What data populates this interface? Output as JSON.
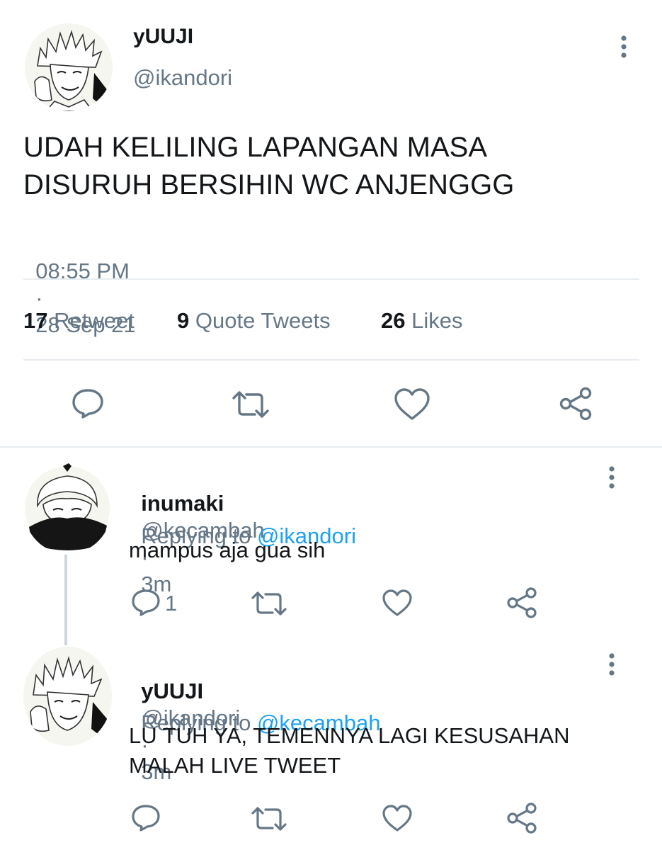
{
  "main_tweet": {
    "display_name": "yUUJI",
    "handle": "@ikandori",
    "text_line1": "UDAH KELILING LAPANGAN MASA",
    "text_line2": "DISURUH BERSIHIN WC ANJENGGG",
    "time": "08:55 PM",
    "separator": "·",
    "date": "28 Sep 21",
    "stats": {
      "retweets_count": "17",
      "retweets_label": "Retweet",
      "quotes_count": "9",
      "quotes_label": "Quote Tweets",
      "likes_count": "26",
      "likes_label": "Likes"
    }
  },
  "replies": [
    {
      "display_name": "inumaki",
      "handle": "@kecambah",
      "age": "3m",
      "separator": "·",
      "replying_prefix": "Replying to",
      "replying_to": "@ikandori",
      "text": "mampus aja gua sih",
      "reply_count": "1"
    },
    {
      "display_name": "yUUJI",
      "handle": "@ikandori",
      "age": "3m",
      "separator": "·",
      "replying_prefix": "Replying to",
      "replying_to": "@kecambah",
      "text_line1": "LU TUH YA, TEMENNYA LAGI KESUSAHAN",
      "text_line2": "MALAH LIVE TWEET",
      "reply_count": ""
    }
  ],
  "icons": {
    "reply": "reply-icon",
    "retweet": "retweet-icon",
    "like": "heart-icon",
    "share": "share-icon",
    "more": "more-vertical-icon"
  },
  "colors": {
    "text": "#14171a",
    "secondary": "#657786",
    "link": "#1da1f2",
    "divider": "#e6ecf0",
    "thread_line": "#ccd6dd"
  }
}
